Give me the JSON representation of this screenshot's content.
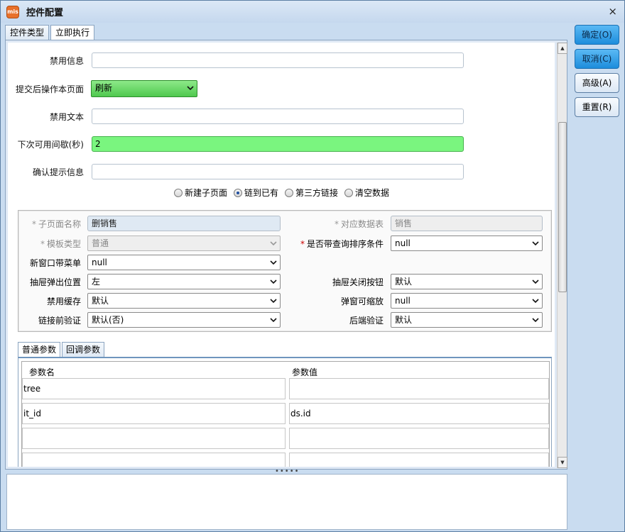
{
  "window": {
    "title": "控件配置",
    "icon_text": "mis",
    "close_glyph": "×"
  },
  "top_tabs": [
    "控件类型",
    "立即执行"
  ],
  "form": {
    "disable_info_label": "禁用信息",
    "disable_info_value": "",
    "after_submit_label": "提交后操作本页面",
    "after_submit_value": "刷新",
    "disable_text_label": "禁用文本",
    "disable_text_value": "",
    "next_available_label": "下次可用间歇(秒)",
    "next_available_value": "2",
    "confirm_label": "确认提示信息",
    "confirm_value": ""
  },
  "radios": {
    "options": [
      "新建子页面",
      "链到已有",
      "第三方链接",
      "清空数据"
    ],
    "selected": "链到已有"
  },
  "group": {
    "subpage_name_label": "子页面名称",
    "subpage_name_value": "删销售",
    "data_table_label": "对应数据表",
    "data_table_value": "销售",
    "template_type_label": "模板类型",
    "template_type_value": "普通",
    "sort_cond_label": "是否带查询排序条件",
    "sort_cond_value": "null",
    "new_window_menu_label": "新窗口带菜单",
    "new_window_menu_value": "null",
    "drawer_position_label": "抽屉弹出位置",
    "drawer_position_value": "左",
    "drawer_close_label": "抽屉关闭按钮",
    "drawer_close_value": "默认",
    "disable_cache_label": "禁用缓存",
    "disable_cache_value": "默认",
    "popup_scalable_label": "弹窗可缩放",
    "popup_scalable_value": "null",
    "pre_link_verify_label": "链接前验证",
    "pre_link_verify_value": "默认(否)",
    "backend_verify_label": "后端验证",
    "backend_verify_value": "默认"
  },
  "param_tabs": [
    "普通参数",
    "回调参数"
  ],
  "params": {
    "col_name": "参数名",
    "col_value": "参数值",
    "rows": [
      {
        "name": "tree",
        "value": ""
      },
      {
        "name": "it_id",
        "value": "ds.id"
      },
      {
        "name": "",
        "value": ""
      },
      {
        "name": "",
        "value": ""
      }
    ]
  },
  "buttons": {
    "ok": "确定(O)",
    "cancel": "取消(C)",
    "advanced": "高级(A)",
    "reset": "重置(R)"
  },
  "colors": {
    "accent_green": "#7af57f",
    "primary_button": "#1d8ddc",
    "window_bg": "#c9dcf0"
  }
}
